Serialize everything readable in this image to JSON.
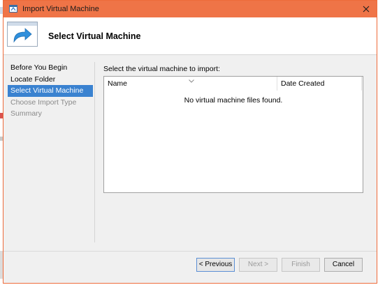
{
  "window": {
    "title": "Import Virtual Machine",
    "close_icon": "close-icon",
    "accent_color": "#ef7447"
  },
  "header": {
    "title": "Select Virtual Machine",
    "icon": "import-arrow-icon"
  },
  "nav": {
    "items": [
      {
        "label": "Before You Begin",
        "state": "normal"
      },
      {
        "label": "Locate Folder",
        "state": "normal"
      },
      {
        "label": "Select Virtual Machine",
        "state": "selected"
      },
      {
        "label": "Choose Import Type",
        "state": "disabled"
      },
      {
        "label": "Summary",
        "state": "disabled"
      }
    ],
    "selected_color": "#3a82d0"
  },
  "main": {
    "prompt": "Select the virtual machine to import:",
    "table": {
      "columns": [
        "Name",
        "Date Created"
      ],
      "empty_message": "No virtual machine files found."
    }
  },
  "buttons": {
    "previous": "< Previous",
    "next": "Next >",
    "finish": "Finish",
    "cancel": "Cancel"
  }
}
